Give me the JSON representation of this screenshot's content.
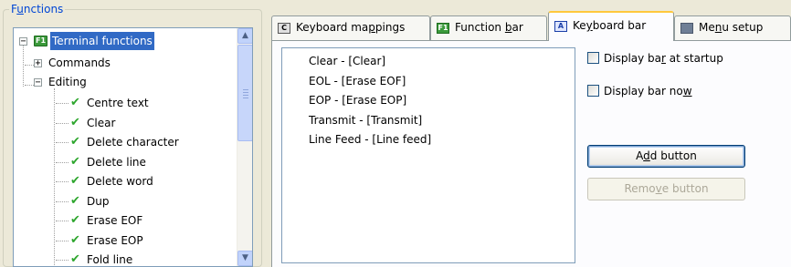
{
  "functions_group": {
    "title_pre": "F",
    "title_u": "u",
    "title_post": "nctions"
  },
  "tree": {
    "root": {
      "label": "Terminal functions",
      "icon": "F1"
    },
    "commands": "Commands",
    "editing": "Editing",
    "items": [
      "Centre text",
      "Clear",
      "Delete character",
      "Delete line",
      "Delete word",
      "Dup",
      "Erase EOF",
      "Erase EOP",
      "Fold line"
    ],
    "expander_collapsed": "+",
    "expander_expanded": "−"
  },
  "tabs": [
    {
      "icon": "C",
      "pre": "Keyboard ma",
      "u": "p",
      "post": "pings"
    },
    {
      "icon": "F1",
      "pre": "Function ",
      "u": "b",
      "post": "ar"
    },
    {
      "icon": "A",
      "pre": "Ke",
      "u": "y",
      "post": "board bar"
    },
    {
      "icon": "",
      "pre": "Me",
      "u": "n",
      "post": "u setup"
    }
  ],
  "keyboard_bar": {
    "list": [
      "Clear - [Clear]",
      "EOL - [Erase EOF]",
      "EOP - [Erase EOP]",
      "Transmit - [Transmit]",
      "Line Feed - [Line feed]"
    ],
    "display_startup": {
      "pre": "Display ba",
      "u": "r",
      "post": " at startup",
      "checked": false
    },
    "display_now": {
      "pre": "Display bar no",
      "u": "w",
      "post": "",
      "checked": false
    },
    "add_button": {
      "pre": "A",
      "u": "d",
      "post": "d button"
    },
    "remove_button": {
      "pre": "Remo",
      "u": "v",
      "post": "e button"
    }
  },
  "colors": {
    "selection": "#316ac5",
    "check": "#2ea62e",
    "group_title": "#0046d5",
    "active_tab_accent": "#ffc83c"
  }
}
